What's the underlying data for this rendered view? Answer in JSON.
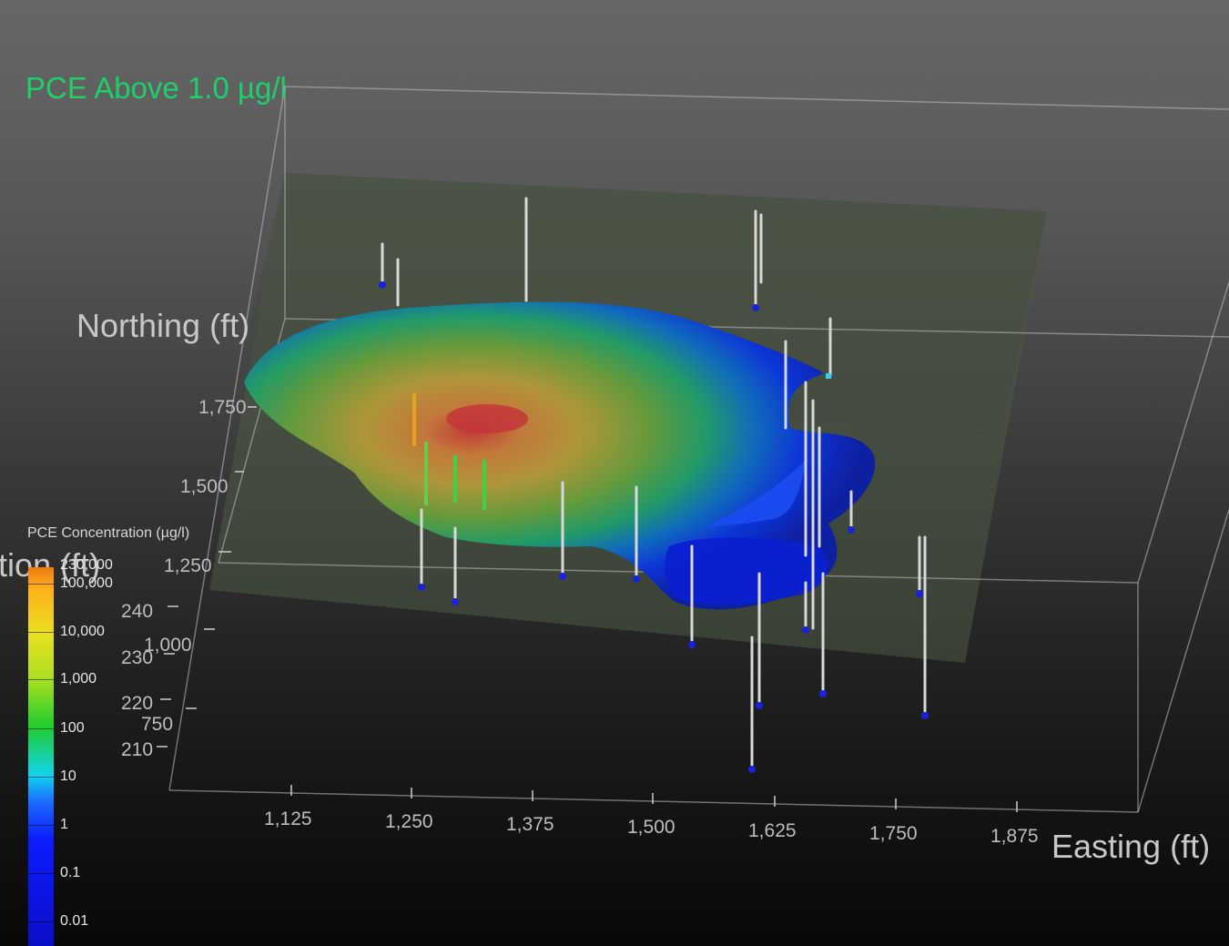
{
  "title": "PCE Above 1.0 µg/l",
  "chart_data": {
    "type": "3d-plume",
    "title": "PCE Above 1.0 µg/l",
    "xlabel": "Easting (ft)",
    "ylabel": "Northing (ft)",
    "zlabel": "Elevation (ft)",
    "x_ticks": [
      "1,125",
      "1,250",
      "1,375",
      "1,500",
      "1,625",
      "1,750",
      "1,875"
    ],
    "y_ticks": [
      "750",
      "1,000",
      "1,250",
      "1,500",
      "1,750"
    ],
    "z_ticks": [
      "210",
      "220",
      "230",
      "240"
    ],
    "colors": {
      "high": "#ff8c00",
      "mid": "#2fd12f",
      "low": "#0033ee",
      "peak": "#cc2a2a"
    },
    "legend": {
      "title": "PCE Concentration (µg/l)",
      "labels": [
        "230,000",
        "100,000",
        "10,000",
        "1,000",
        "100",
        "10",
        "1",
        "0.1",
        "0.01"
      ]
    }
  }
}
